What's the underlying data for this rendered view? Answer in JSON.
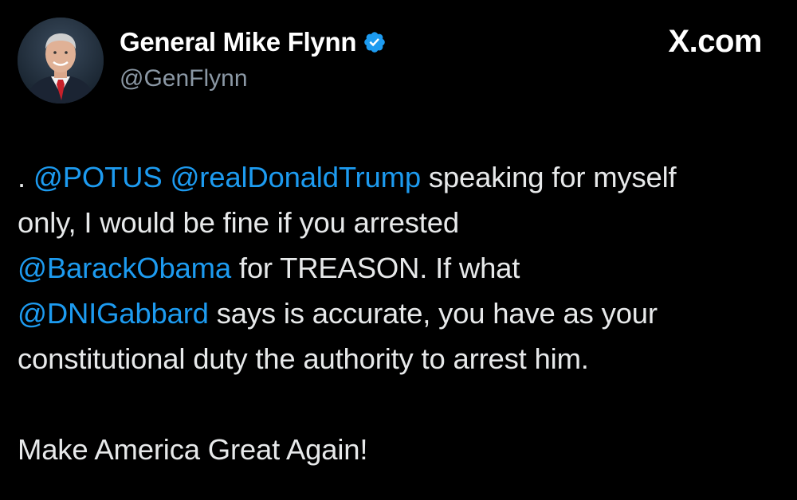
{
  "author": {
    "display_name": "General Mike Flynn",
    "handle": "@GenFlynn",
    "verified_icon": "verified-badge-icon",
    "avatar": "profile-photo"
  },
  "site": {
    "label": "X.com"
  },
  "tweet": {
    "line1_prefix": ". ",
    "mention_potus": "@POTUS",
    "mention_trump": "@realDonaldTrump",
    "line1_suffix": " speaking for myself",
    "line2": "only, I would be fine if you arrested",
    "mention_obama": "@BarackObama",
    "line3_suffix": " for TREASON. If what",
    "mention_gabbard": "@DNIGabbard",
    "line4_suffix": " says is accurate, you have as your",
    "line5": "constitutional duty the authority to arrest him.",
    "closing": "Make America Great Again!"
  },
  "colors": {
    "background": "#000000",
    "text": "#e7e9ea",
    "mention": "#1d9bf0",
    "handle": "#8b98a5",
    "verified": "#1d9bf0"
  }
}
